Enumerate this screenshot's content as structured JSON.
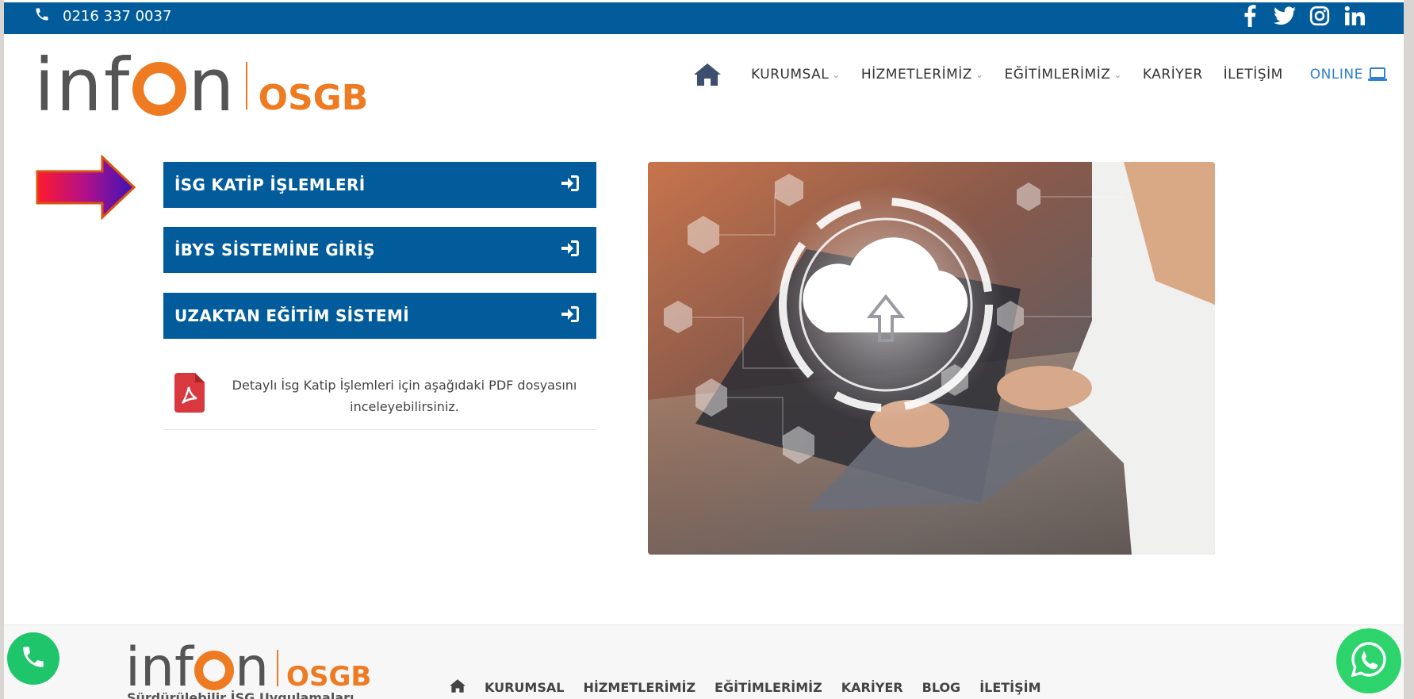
{
  "topbar": {
    "phone": "0216 337 0037",
    "social_icons": [
      "facebook-icon",
      "twitter-icon",
      "instagram-icon",
      "linkedin-icon"
    ]
  },
  "header": {
    "logo_word_left": "inf",
    "logo_word_right": "n",
    "logo_osgb": "OSGB",
    "nav": {
      "kurumsal": "KURUMSAL",
      "hizmetlerimiz": "HİZMETLERİMİZ",
      "egitimlerimiz": "EĞİTİMLERİMİZ",
      "kariyer": "KARİYER",
      "iletisim": "İLETİŞİM",
      "online": "ONLINE"
    }
  },
  "main": {
    "buttons": {
      "isg_katip": "İSG KATİP İŞLEMLERİ",
      "ibys": "İBYS SİSTEMİNE GİRİŞ",
      "uzaktan": "UZAKTAN EĞİTİM SİSTEMİ"
    },
    "pdf_text": "Detaylı İsg Katip İşlemleri için aşağıdaki PDF dosyasını inceleyebilirsiniz."
  },
  "footer": {
    "logo_word_left": "inf",
    "logo_word_right": "n",
    "logo_osgb": "OSGB",
    "tagline": "Sürdürülebilir İSG Uygulamaları",
    "nav": {
      "kurumsal": "KURUMSAL",
      "hizmetlerimiz": "HİZMETLERİMİZ",
      "egitimlerimiz": "EĞİTİMLERİMİZ",
      "kariyer": "KARİYER",
      "blog": "BLOG",
      "iletisim": "İLETİŞİM"
    }
  },
  "colors": {
    "brand_blue": "#025c9c",
    "brand_orange": "#ee7a22",
    "online_blue": "#2f80d1",
    "whatsapp_green": "#2cd46b"
  }
}
